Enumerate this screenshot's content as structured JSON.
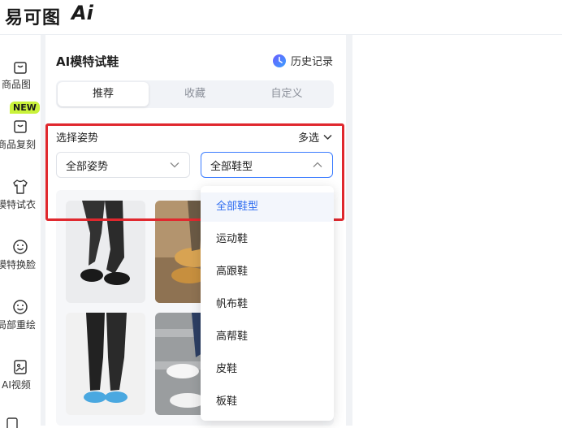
{
  "app": {
    "logo_text": "易可图",
    "logo_ai": "Ai"
  },
  "leftnav": {
    "items": [
      {
        "label": "商品图",
        "icon": "shopping-bag-icon"
      },
      {
        "label": "商品复刻",
        "icon": "copy-bag-icon",
        "badge": "NEW"
      },
      {
        "label": "模特试衣",
        "icon": "tshirt-icon"
      },
      {
        "label": "模特换脸",
        "icon": "face-swap-icon"
      },
      {
        "label": "局部重绘",
        "icon": "face-repaint-icon"
      },
      {
        "label": "AI视频",
        "icon": "video-icon"
      }
    ]
  },
  "panel": {
    "title": "AI模特试鞋",
    "history_label": "历史记录",
    "tabs": [
      {
        "label": "推荐",
        "active": true
      },
      {
        "label": "收藏",
        "active": false
      },
      {
        "label": "自定义",
        "active": false
      }
    ],
    "section_label": "选择姿势",
    "multi_select_label": "多选",
    "pose_select": {
      "value": "全部姿势"
    },
    "shoe_select": {
      "value": "全部鞋型",
      "open": true
    }
  },
  "dropdown": {
    "options": [
      {
        "label": "全部鞋型",
        "selected": true
      },
      {
        "label": "运动鞋",
        "selected": false
      },
      {
        "label": "高跟鞋",
        "selected": false
      },
      {
        "label": "帆布鞋",
        "selected": false
      },
      {
        "label": "高帮鞋",
        "selected": false
      },
      {
        "label": "皮鞋",
        "selected": false
      },
      {
        "label": "板鞋",
        "selected": false
      }
    ]
  },
  "colors": {
    "accent": "#2f6df0",
    "highlight_border": "#e0282e",
    "new_badge": "#c9f23a"
  }
}
